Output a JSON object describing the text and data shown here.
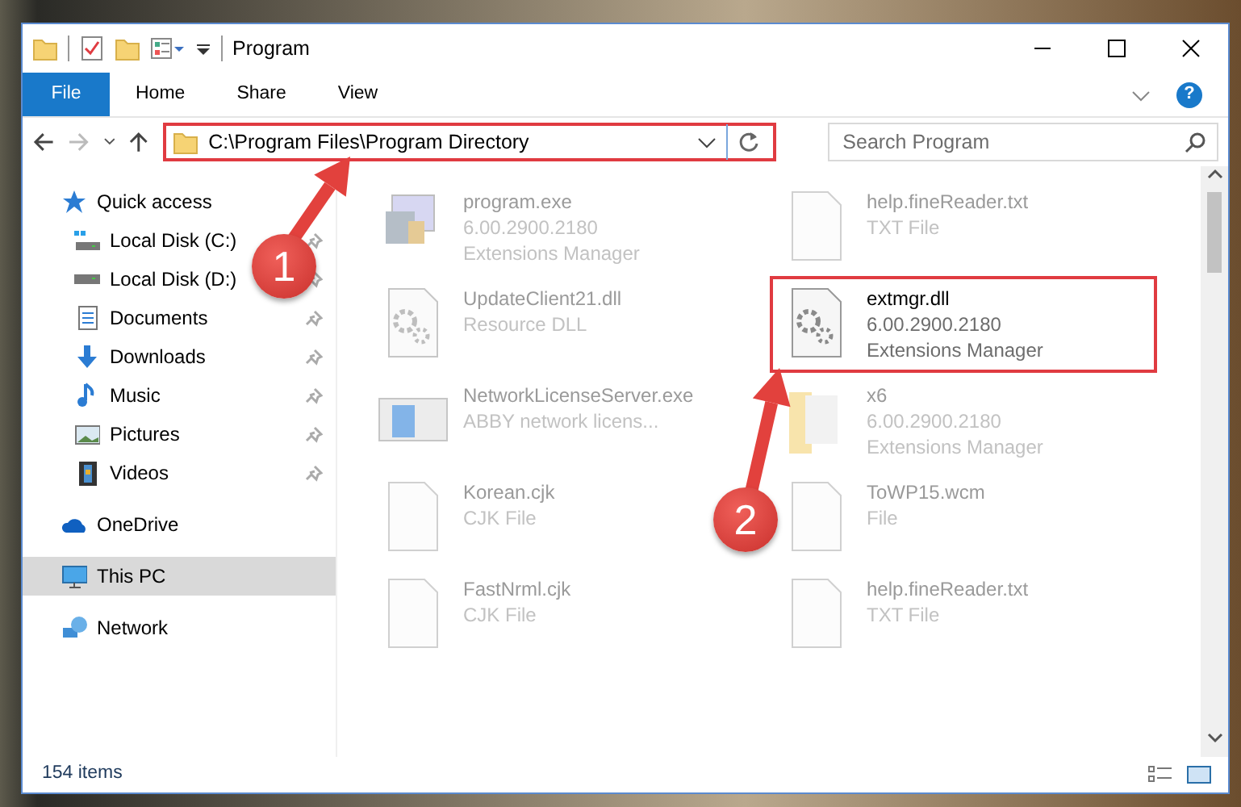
{
  "window": {
    "title": "Program",
    "tabs": [
      {
        "label": "File",
        "kind": "menu"
      },
      {
        "label": "Home",
        "kind": "tab"
      },
      {
        "label": "Share",
        "kind": "tab"
      },
      {
        "label": "View",
        "kind": "tab"
      }
    ],
    "help_button": "?"
  },
  "address_bar": {
    "path": "C:\\Program Files\\Program Directory",
    "highlighted": true
  },
  "search": {
    "placeholder": "Search Program"
  },
  "sidebar": {
    "items": [
      {
        "label": "Quick access",
        "kind": "star",
        "selected": false,
        "children": [
          {
            "label": "Local Disk (C:)",
            "kind": "windisk",
            "pinned": true,
            "selected": false
          },
          {
            "label": "Local Disk (D:)",
            "kind": "disk",
            "pinned": true,
            "selected": false
          },
          {
            "label": "Documents",
            "kind": "documents",
            "pinned": true,
            "selected": false
          },
          {
            "label": "Downloads",
            "kind": "downloads",
            "pinned": true,
            "selected": false
          },
          {
            "label": "Music",
            "kind": "music",
            "pinned": true,
            "selected": false
          },
          {
            "label": "Pictures",
            "kind": "pictures",
            "pinned": true,
            "selected": false
          },
          {
            "label": "Videos",
            "kind": "videos",
            "pinned": true,
            "selected": false
          }
        ]
      },
      {
        "label": "OneDrive",
        "kind": "cloud",
        "selected": false
      },
      {
        "label": "This PC",
        "kind": "pc",
        "selected": true
      },
      {
        "label": "Network",
        "kind": "network",
        "selected": false
      }
    ]
  },
  "files": [
    {
      "name": "program.exe",
      "details": [
        "6.00.2900.2180",
        "Extensions Manager"
      ],
      "kind": "exe",
      "blurred": true,
      "highlighted": false
    },
    {
      "name": "help.fineReader.txt",
      "details": [
        "TXT File"
      ],
      "kind": "blank",
      "blurred": true,
      "highlighted": false
    },
    {
      "name": "UpdateClient21.dll",
      "details": [
        "Resource DLL"
      ],
      "kind": "dll",
      "blurred": true,
      "highlighted": false
    },
    {
      "name": "extmgr.dll",
      "details": [
        "6.00.2900.2180",
        "Extensions Manager"
      ],
      "kind": "dll",
      "blurred": false,
      "highlighted": true
    },
    {
      "name": "NetworkLicenseServer.exe",
      "details": [
        "ABBY network licens..."
      ],
      "kind": "app",
      "blurred": true,
      "highlighted": false
    },
    {
      "name": "x6",
      "details": [
        "6.00.2900.2180",
        "Extensions Manager"
      ],
      "kind": "folder",
      "blurred": true,
      "highlighted": false
    },
    {
      "name": "Korean.cjk",
      "details": [
        "CJK File"
      ],
      "kind": "blank",
      "blurred": true,
      "highlighted": false
    },
    {
      "name": "ToWP15.wcm",
      "details": [
        "File"
      ],
      "kind": "blank",
      "blurred": true,
      "highlighted": false
    },
    {
      "name": "FastNrml.cjk",
      "details": [
        "CJK File"
      ],
      "kind": "blank",
      "blurred": true,
      "highlighted": false
    },
    {
      "name": "help.fineReader.txt",
      "details": [
        "TXT File"
      ],
      "kind": "blank",
      "blurred": true,
      "highlighted": false
    }
  ],
  "annotations": [
    {
      "label": "1"
    },
    {
      "label": "2"
    }
  ],
  "status_bar": {
    "item_count": "154 items"
  }
}
